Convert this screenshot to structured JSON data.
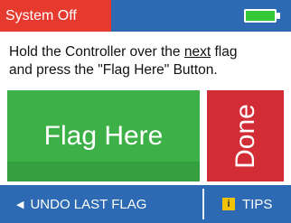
{
  "status": {
    "label": "System Off"
  },
  "battery": {
    "level": 1.0,
    "color": "#35c93a"
  },
  "instruction": {
    "line1_pre": "Hold the Controller over the ",
    "line1_underlined": "next",
    "line1_post": " flag",
    "line2": "and press the \"Flag Here\" Button."
  },
  "buttons": {
    "flag_here": "Flag Here",
    "done": "Done"
  },
  "footer": {
    "undo_icon": "left-arrow-icon",
    "undo_label": "UNDO LAST FLAG",
    "tips_icon": "info-icon",
    "tips_icon_glyph": "i",
    "tips_label": "TIPS"
  },
  "colors": {
    "bar_blue": "#2d6ab3",
    "status_red": "#e63a2f",
    "flag_green": "#3db047",
    "done_red": "#d22d36",
    "tips_yellow": "#f2c200"
  }
}
